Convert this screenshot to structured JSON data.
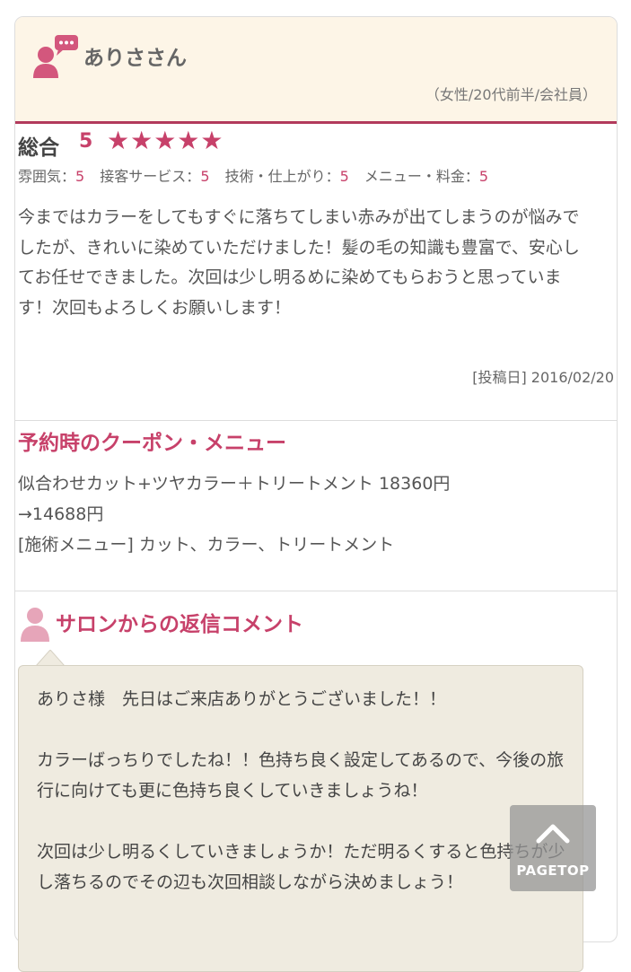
{
  "reviewer": {
    "name": "ありささん",
    "profile": "（女性/20代前半/会社員）"
  },
  "rating": {
    "overall_label": "総合",
    "overall_score": "5",
    "stars": "★★★★★",
    "items": [
      {
        "label": "雰囲気：",
        "value": "5"
      },
      {
        "label": "接客サービス：",
        "value": "5"
      },
      {
        "label": "技術・仕上がり：",
        "value": "5"
      },
      {
        "label": "メニュー・料金：",
        "value": "5"
      }
    ]
  },
  "review": {
    "body": "今まではカラーをしてもすぐに落ちてしまい赤みが出てしまうのが悩みでしたが、きれいに染めていただけました！髪の毛の知識も豊富で、安心してお任せできました。次回は少し明るめに染めてもらおうと思っています！次回もよろしくお願いします！",
    "post_date": "[投稿日] 2016/02/20"
  },
  "coupon": {
    "title": "予約時のクーポン・メニュー",
    "line1": "似合わせカット+ツヤカラー＋トリートメント 18360円",
    "line2": "→14688円",
    "line3": "[施術メニュー] カット、カラー、トリートメント"
  },
  "reply": {
    "title": "サロンからの返信コメント",
    "text": "ありさ様　先日はご来店ありがとうございました！！\n\nカラーばっちりでしたね！！色持ち良く設定してあるので、今後の旅行に向けても更に色持ち良くしていきましょうね！\n\n次回は少し明るくしていきましょうか！ただ明るくすると色持ちが少し落ちるのでその辺も次回相談しながら決めましょう！"
  },
  "pagetop": {
    "label": "PAGETOP"
  },
  "colors": {
    "accent": "#c7416a",
    "header_bg": "#fdf5e7",
    "reply_bg": "#efebe0"
  },
  "icons": [
    "user-chat-icon",
    "salon-person-icon",
    "chevron-up-icon"
  ]
}
